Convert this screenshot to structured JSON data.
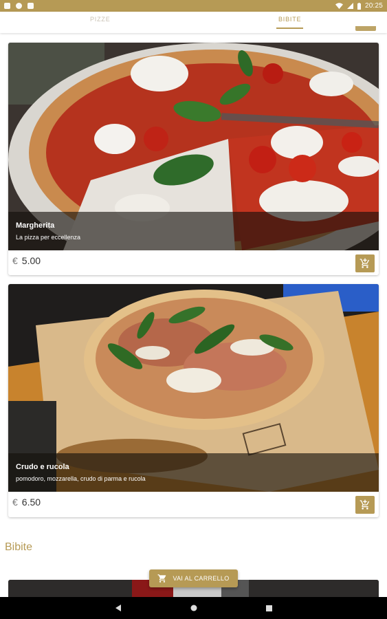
{
  "status_bar": {
    "time": "20:25"
  },
  "tabs": [
    {
      "label": "PIZZE"
    },
    {
      "label": "BIBITE"
    }
  ],
  "products": [
    {
      "name": "Margherita",
      "description": "La pizza per eccellenza",
      "currency": "€",
      "price": "5.00"
    },
    {
      "name": "Crudo e rucola",
      "description": "pomodoro, mozzarella, crudo di parma e rucola",
      "currency": "€",
      "price": "6.50"
    }
  ],
  "section_bibite": {
    "title": "Bibite"
  },
  "cart_button": {
    "label": "VAI AL CARRELLO"
  },
  "colors": {
    "accent": "#b69a55"
  },
  "icons": {
    "cart": "add-shopping-cart-icon",
    "back": "back-icon",
    "home": "home-icon",
    "recents": "recents-icon"
  }
}
